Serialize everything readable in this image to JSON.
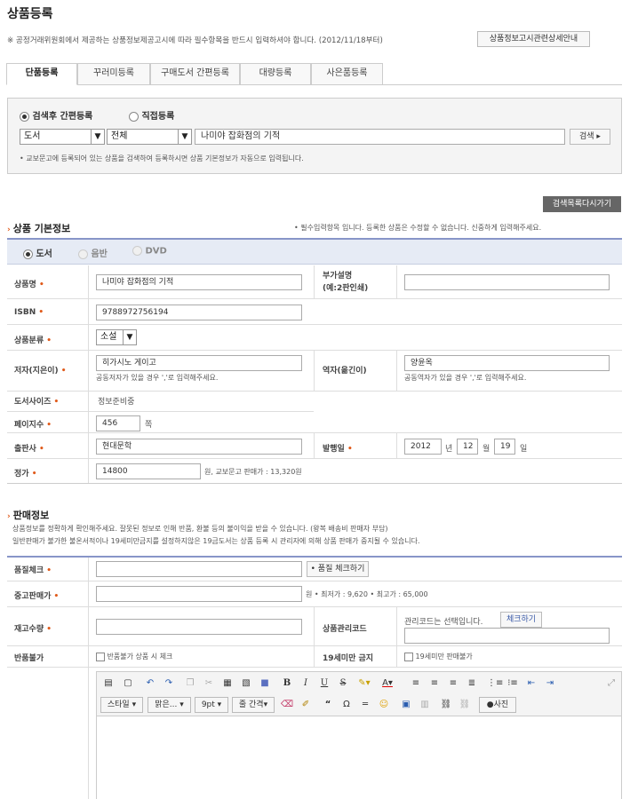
{
  "page": {
    "title": "상품등록",
    "notice": "※ 공정거래위원회에서 제공하는 상품정보제공고시에 따라 필수항목을 반드시 입력하셔야 합니다. (2012/11/18부터)",
    "notice_button": "상품정보고시관련상세안내"
  },
  "tabs": [
    "단품등록",
    "꾸러미등록",
    "구매도서 간편등록",
    "대량등록",
    "사은품등록"
  ],
  "search": {
    "option_search": "검색후 간편등록",
    "option_direct": "직접등록",
    "category": "도서",
    "scope": "전체",
    "query": "나미야 잡화점의 기적",
    "button": "검색 ▸",
    "help": "• 교보문고에 등록되어 있는 상품을 검색하여 등록하시면 상품 기본정보가 자동으로 입력됩니다."
  },
  "back_button": "검색목록다시가기",
  "basic": {
    "title": "상품 기본정보",
    "required_note": "• 필수입력항목 입니다. 등록한 상품은 수정할 수 없습니다. 신중하게 입력해주세요.",
    "types": [
      "도서",
      "음반",
      "DVD"
    ]
  },
  "fields": {
    "name": {
      "label": "상품명",
      "value": "나미야 잡화점의 기적"
    },
    "extra": {
      "label": "부가설명",
      "sub": "(예:2판인쇄)",
      "value": ""
    },
    "isbn": {
      "label": "ISBN",
      "value": "9788972756194"
    },
    "category": {
      "label": "상품분류",
      "value": "소설"
    },
    "author": {
      "label": "저자(지은이)",
      "value": "히가시노 게이고",
      "hint": "공동저자가 있을 경우 ','로 입력해주세요."
    },
    "translator": {
      "label": "역자(옮긴이)",
      "value": "양윤옥",
      "hint": "공동역자가 있을 경우 ','로 입력해주세요."
    },
    "size": {
      "label": "도서사이즈",
      "value": "정보준비중"
    },
    "pages": {
      "label": "페이지수",
      "value": "456",
      "unit": "쪽"
    },
    "publisher": {
      "label": "출판사",
      "value": "현대문학"
    },
    "pubdate": {
      "label": "발행일",
      "year": "2012",
      "year_unit": "년",
      "month": "12",
      "month_unit": "월",
      "day": "19",
      "day_unit": "일"
    },
    "price": {
      "label": "정가",
      "value": "14800",
      "note": "원, 교보문고 판매가 : 13,320원"
    }
  },
  "sale": {
    "title": "판매정보",
    "desc1": "상품정보를 정확하게 확인해주세요. 잘못된 정보로 인해 반품, 환불 등의 불이익을 받을 수 있습니다. (왕복 배송비 판매자 부담)",
    "desc2": "일반판매가 불가한 불온서적이나 19세미만금지를 설정하지않은 19금도서는 상품 등록 시 관리자에 의해 상품 판매가 중지될 수 있습니다.",
    "quality": {
      "label": "품질체크",
      "button": "• 품질 체크하기"
    },
    "used_price": {
      "label": "중고판매가",
      "note": "원  • 최저가 : 9,620  • 최고가 : 65,000"
    },
    "stock": {
      "label": "재고수량"
    },
    "code": {
      "label": "상품관리코드",
      "note": "관리코드는 선택입니다.",
      "button": "체크하기"
    },
    "noreturn": {
      "label": "반품불가",
      "check": "반품불가 상품 시 체크"
    },
    "adult": {
      "label": "19세미만 금지",
      "check": "19세미만 판매불가"
    }
  },
  "editor": {
    "style": "스타일",
    "font": "맑은...",
    "size": "9pt",
    "spacing": "줄 간격",
    "photo": "사진"
  }
}
